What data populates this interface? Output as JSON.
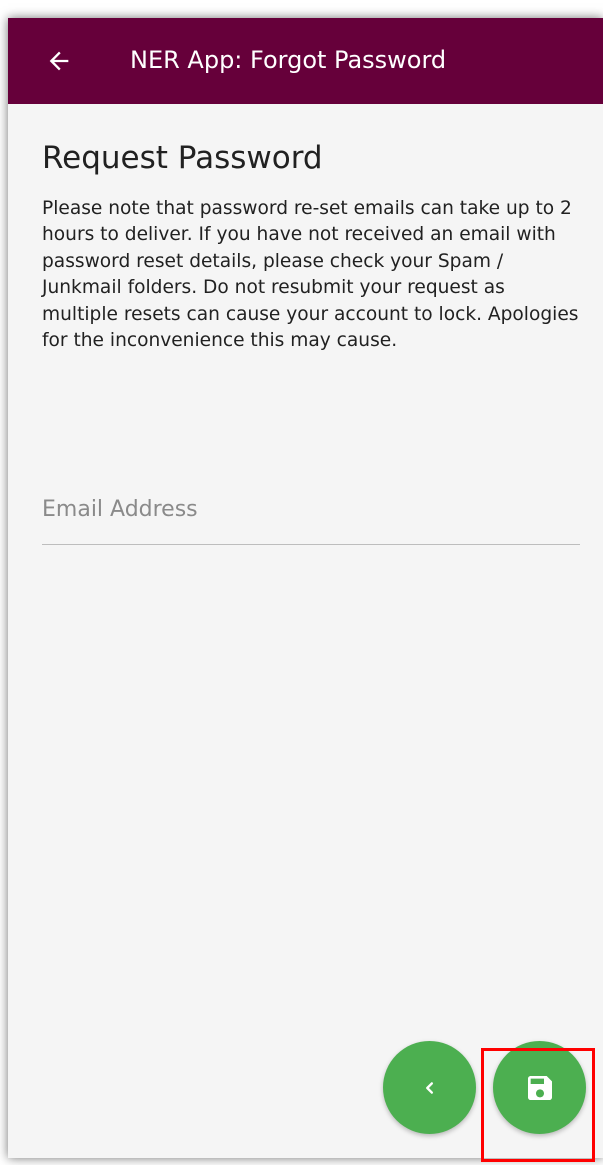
{
  "appbar": {
    "title": "NER App: Forgot Password",
    "back_icon": "arrow-left-icon",
    "background_color": "#66003a"
  },
  "main": {
    "heading": "Request Password",
    "notice": "Please note that password re-set emails can take up to 2 hours to deliver. If you have not received an email with password reset details, please check your Spam / Junkmail folders. Do not resubmit your request as multiple resets can cause your account to lock. Apologies for the inconvenience this may cause."
  },
  "email_field": {
    "placeholder": "Email Address",
    "value": ""
  },
  "fabs": {
    "back_icon": "chevron-left-icon",
    "save_icon": "save-floppy-icon",
    "color": "#4caf50"
  },
  "annotation": {
    "highlight_color": "#ff0000"
  }
}
